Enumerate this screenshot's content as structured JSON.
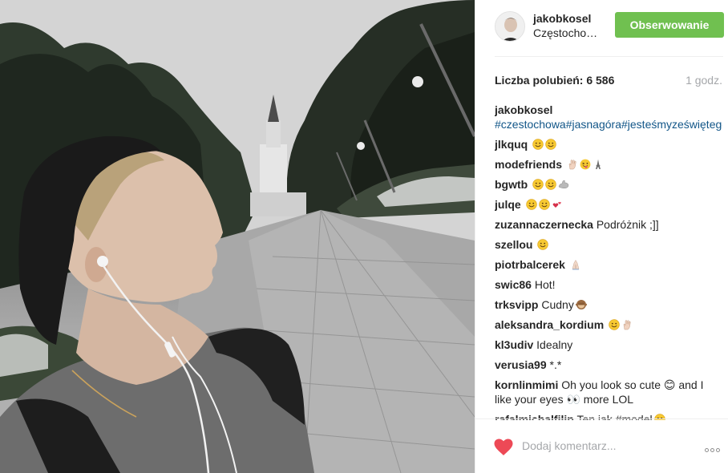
{
  "header": {
    "username": "jakobkosel",
    "location": "Częstocho…",
    "follow_label": "Obserwowanie"
  },
  "stats": {
    "likes_text": "Liczba polubień: 6 586",
    "time": "1 godz."
  },
  "caption": {
    "user": "jakobkosel",
    "text": "#czestochowa#jasnagóra#jesteśmyzeświętegomiasta"
  },
  "comments": [
    {
      "user": "jlkquq",
      "text": "",
      "emoji": [
        "smile",
        "smile"
      ]
    },
    {
      "user": "modefriends",
      "text": "",
      "emoji": [
        "hand",
        "tongue",
        "tower"
      ]
    },
    {
      "user": "bgwtb",
      "text": "",
      "emoji": [
        "smile",
        "smile",
        "muscle"
      ]
    },
    {
      "user": "julqe",
      "text": "",
      "emoji": [
        "smile",
        "smile",
        "hearts"
      ]
    },
    {
      "user": "zuzannaczernecka",
      "text": "Podróżnik ;]]",
      "emoji": []
    },
    {
      "user": "szellou",
      "text": "",
      "emoji": [
        "smile"
      ]
    },
    {
      "user": "piotrbalcerek",
      "text": "",
      "emoji": [
        "pray"
      ]
    },
    {
      "user": "swic86",
      "text": "Hot!",
      "emoji": []
    },
    {
      "user": "trksvipp",
      "text": "Cudny",
      "emoji": [
        "monkey"
      ]
    },
    {
      "user": "aleksandra_kordium",
      "text": "",
      "emoji": [
        "smile",
        "hand"
      ]
    },
    {
      "user": "kl3udiv",
      "text": "Idealny",
      "emoji": []
    },
    {
      "user": "verusia99",
      "text": "*.*",
      "emoji": []
    },
    {
      "user": "kornlinmimi",
      "text": "Oh you look so cute 😊 and I like your eyes 👀 more LOL",
      "emoji": []
    },
    {
      "user": "rafalmichalfilip",
      "text": "Ten jak #model",
      "emoji": [
        "smile"
      ]
    }
  ],
  "footer": {
    "comment_placeholder": "Dodaj komentarz..."
  },
  "icons": {
    "heart": "heart-icon",
    "more": "more-options-icon"
  },
  "colors": {
    "follow_button": "#70c050",
    "heart": "#ed4956",
    "hashtag": "#125688",
    "muted": "#a5a7aa"
  }
}
